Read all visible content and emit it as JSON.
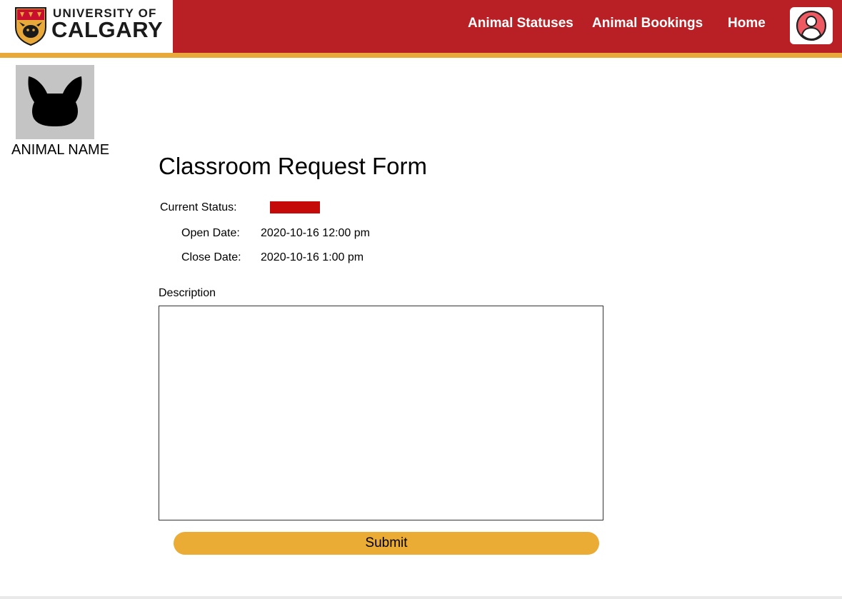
{
  "header": {
    "logo": {
      "line1": "UNIVERSITY OF",
      "line2": "CALGARY"
    },
    "nav": [
      {
        "label": "Animal Statuses"
      },
      {
        "label": "Animal Bookings"
      },
      {
        "label": "Home"
      }
    ],
    "profile_icon": "user-avatar-icon"
  },
  "colors": {
    "header_red": "#b82025",
    "accent_gold": "#e8a93a",
    "status_red": "#c50a0a",
    "submit_button": "#ebac36"
  },
  "animal": {
    "name": "ANIMAL NAME",
    "image_icon": "animal-silhouette-icon"
  },
  "form": {
    "title": "Classroom Request Form",
    "status_label": "Current Status:",
    "open_label": "Open Date:",
    "open_value": "2020-10-16 12:00 pm",
    "close_label": "Close Date:",
    "close_value": "2020-10-16 1:00 pm",
    "description_label": "Description",
    "description_value": "",
    "submit_label": "Submit"
  }
}
